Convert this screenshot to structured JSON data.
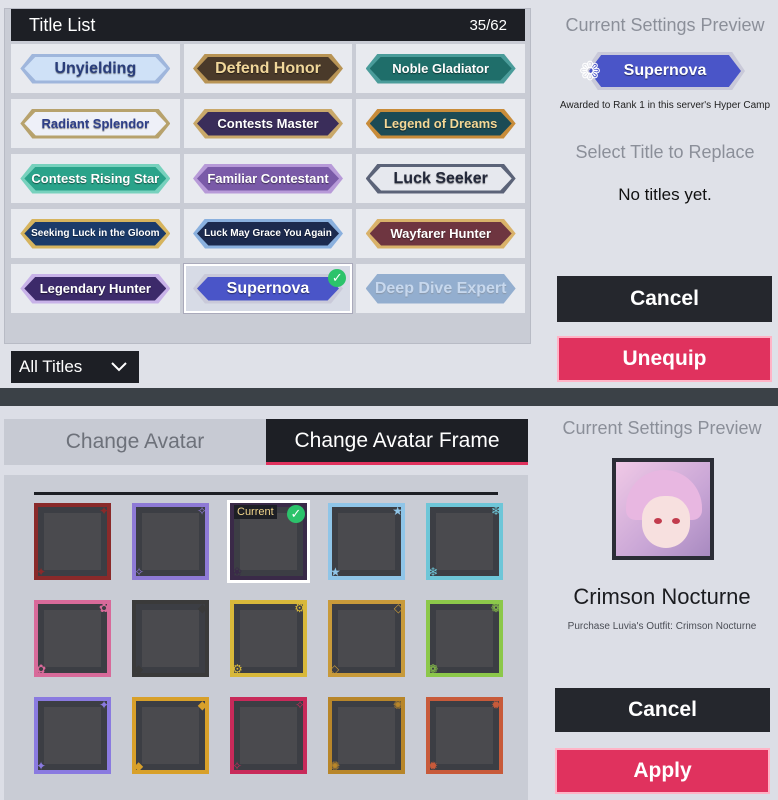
{
  "title_list": {
    "header": "Title List",
    "count": "35/62",
    "rows": [
      [
        {
          "label": "Unyielding",
          "bg": "#cfe1f7",
          "fg": "#2a3e7c",
          "border": "#9fb6dc",
          "size": ""
        },
        {
          "label": "Defend Honor",
          "bg": "#4a3a2a",
          "fg": "#f1d79a",
          "border": "#b89455",
          "size": ""
        },
        {
          "label": "Noble Gladiator",
          "bg": "#1f6e6a",
          "fg": "#ffffff",
          "border": "#4a9c9a",
          "size": "med"
        }
      ],
      [
        {
          "label": "Radiant Splendor",
          "bg": "#eef0f8",
          "fg": "#2e3f8a",
          "border": "#b7a26d",
          "size": "med"
        },
        {
          "label": "Contests Master",
          "bg": "#3a2d5a",
          "fg": "#ffffff",
          "border": "#c9a86a",
          "size": "med"
        },
        {
          "label": "Legend of Dreams",
          "bg": "#1c4b55",
          "fg": "#f5d896",
          "border": "#c88c3a",
          "size": "med"
        }
      ],
      [
        {
          "label": "Contests Rising Star",
          "bg": "#2aa38a",
          "fg": "#ffffff",
          "border": "#77d1bd",
          "size": "med"
        },
        {
          "label": "Familiar Contestant",
          "bg": "#7a5aa8",
          "fg": "#ffffff",
          "border": "#b79ad8",
          "size": "med"
        },
        {
          "label": "Luck Seeker",
          "bg": "#e6e8ee",
          "fg": "#23283a",
          "border": "#5b6378",
          "size": ""
        }
      ],
      [
        {
          "label": "Seeking Luck in the Gloom",
          "bg": "#1b3b6a",
          "fg": "#ffffff",
          "border": "#d6b45e",
          "size": "small"
        },
        {
          "label": "Luck May Grace You Again",
          "bg": "#1c2a4e",
          "fg": "#ffffff",
          "border": "#8ab0de",
          "size": "small"
        },
        {
          "label": "Wayfarer Hunter",
          "bg": "#6e3540",
          "fg": "#ffffff",
          "border": "#d9b26a",
          "size": "med"
        }
      ],
      [
        {
          "label": "Legendary Hunter",
          "bg": "#3c2a6a",
          "fg": "#ffffff",
          "border": "#c8b2e8",
          "size": "med"
        },
        {
          "label": "Supernova",
          "bg": "#4a55c8",
          "fg": "#ffffff",
          "border": "#c9c9d9",
          "size": "",
          "selected": true
        },
        {
          "label": "Deep Dive Expert",
          "bg": "#2e67a8",
          "fg": "#9fc4ee",
          "border": "#2e67a8",
          "size": "",
          "faint": true
        }
      ]
    ],
    "filter_label": "All Titles",
    "filter_icon": "chevron-down-icon"
  },
  "top_preview": {
    "label": "Current Settings Preview",
    "badge_label": "Supernova",
    "award_text": "Awarded to Rank 1 in this server's Hyper Camp",
    "select_title_label": "Select Title to Replace",
    "no_titles_text": "No titles yet.",
    "cancel_label": "Cancel",
    "unequip_label": "Unequip"
  },
  "tabs": {
    "avatar_label": "Change Avatar",
    "frame_label": "Change Avatar Frame"
  },
  "frames": {
    "current_tag": "Current",
    "rows": [
      [
        {
          "color": "#8a2a2a",
          "deco": "✦"
        },
        {
          "color": "#8e7ad6",
          "deco": "✧"
        },
        {
          "color": "#3a2a48",
          "deco": "❀",
          "current": true
        },
        {
          "color": "#8fc5e8",
          "deco": "★"
        },
        {
          "color": "#6ec6d8",
          "deco": "❄"
        }
      ],
      [
        {
          "color": "#d86a9a",
          "deco": "✿"
        },
        {
          "color": "#3a3a3a",
          "deco": "◆"
        },
        {
          "color": "#d8b83a",
          "deco": "⚙"
        },
        {
          "color": "#c89a3a",
          "deco": "◇"
        },
        {
          "color": "#8cc84a",
          "deco": "❁"
        }
      ],
      [
        {
          "color": "#8a7ae0",
          "deco": "✦"
        },
        {
          "color": "#d8a02a",
          "deco": "◆"
        },
        {
          "color": "#c82a5a",
          "deco": "✧"
        },
        {
          "color": "#b8862a",
          "deco": "✺"
        },
        {
          "color": "#c85a3a",
          "deco": "✹"
        }
      ]
    ]
  },
  "bottom_preview": {
    "label": "Current Settings Preview",
    "frame_name": "Crimson Nocturne",
    "frame_desc": "Purchase Luvia's Outfit: Crimson Nocturne",
    "cancel_label": "Cancel",
    "apply_label": "Apply"
  },
  "colors": {
    "accent_pink": "#e0325e",
    "dark": "#1d1f25",
    "check_green": "#2cc36b"
  }
}
